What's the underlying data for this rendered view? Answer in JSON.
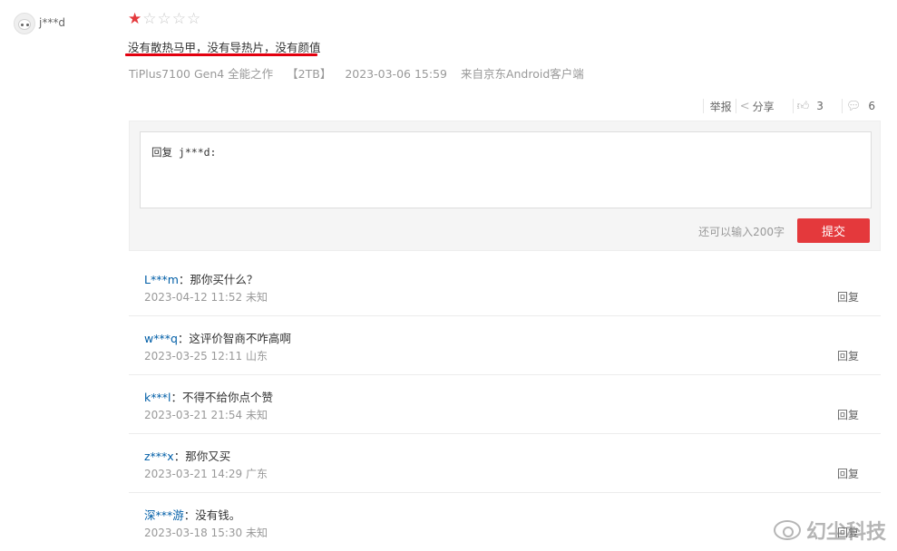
{
  "review": {
    "username": "j***d",
    "rating": 1,
    "max_rating": 5,
    "text": "没有散热马甲，没有导热片，没有颜值",
    "product": "TiPlus7100 Gen4 全能之作",
    "capacity": "【2TB】",
    "datetime": "2023-03-06 15:59",
    "source": "来自京东Android客户端"
  },
  "actions": {
    "report_label": "举报",
    "share_label": "分享",
    "like_count": "3",
    "comment_count": "6"
  },
  "reply_form": {
    "placeholder": "回复 j***d:",
    "remaining": "还可以输入200字",
    "submit_label": "提交"
  },
  "replies": [
    {
      "user": "L***m",
      "text": "：那你买什么？",
      "datetime": "2023-04-12 11:52",
      "location": "未知",
      "reply_label": "回复"
    },
    {
      "user": "w***q",
      "text": "：这评价智商不咋高啊",
      "datetime": "2023-03-25 12:11",
      "location": "山东",
      "reply_label": "回复"
    },
    {
      "user": "k***l",
      "text": "：不得不给你点个赞",
      "datetime": "2023-03-21 21:54",
      "location": "未知",
      "reply_label": "回复"
    },
    {
      "user": "z***x",
      "text": "：那你又买",
      "datetime": "2023-03-21 14:29",
      "location": "广东",
      "reply_label": "回复"
    },
    {
      "user": "深***游",
      "text": "：没有钱。",
      "datetime": "2023-03-18 15:30",
      "location": "未知",
      "reply_label": "回复"
    }
  ],
  "watermark": "幻尘科技",
  "colors": {
    "accent": "#e4393c",
    "link": "#005ea7",
    "underline": "#e3000f"
  }
}
